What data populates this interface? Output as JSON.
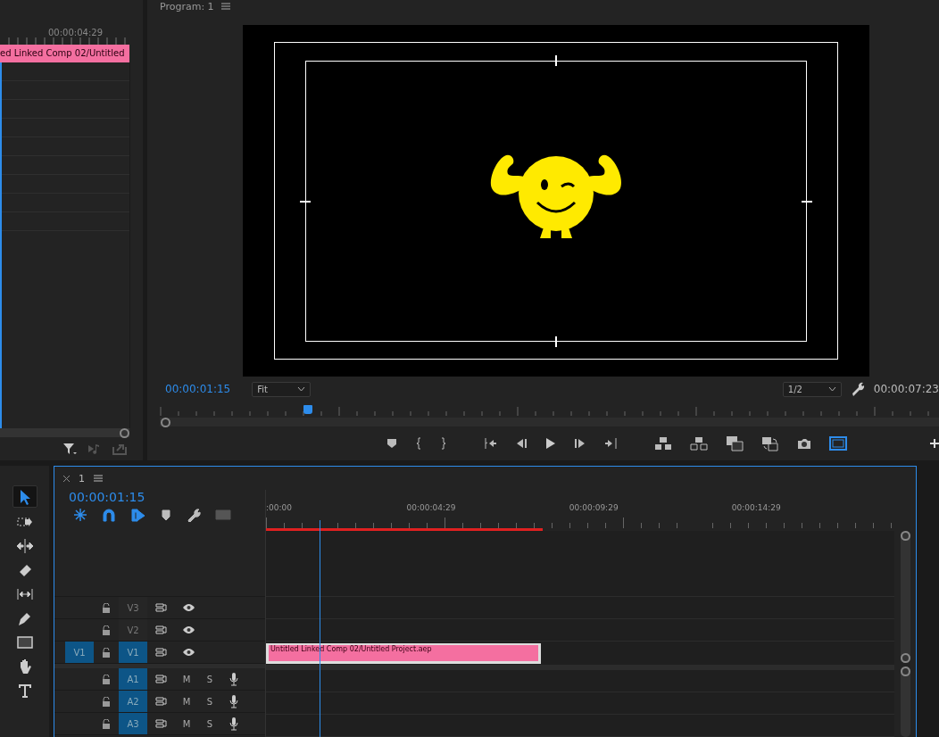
{
  "source_panel": {
    "ruler_label": "00:00:04:29",
    "clip_label": "ed Linked Comp 02/Untitled"
  },
  "program_monitor": {
    "title": "Program: 1",
    "timecode": "00:00:01:15",
    "zoom": "Fit",
    "resolution": "1/2",
    "duration": "00:00:07:23",
    "safe_margins": true,
    "playhead": {
      "level": 0.19
    }
  },
  "tools": [
    {
      "kind": "selection",
      "selected": true
    },
    {
      "kind": "track-select",
      "selected": false
    },
    {
      "kind": "ripple",
      "selected": false
    },
    {
      "kind": "razor",
      "selected": false
    },
    {
      "kind": "slip",
      "selected": false
    },
    {
      "kind": "pen",
      "selected": false
    },
    {
      "kind": "rectangle",
      "selected": false
    },
    {
      "kind": "hand",
      "selected": false
    },
    {
      "kind": "type",
      "selected": false
    }
  ],
  "timeline": {
    "tab": "1",
    "timecode": "00:00:01:15",
    "toggles": [
      {
        "kind": "nest",
        "on": true
      },
      {
        "kind": "snap",
        "on": true
      },
      {
        "kind": "linked",
        "on": true
      },
      {
        "kind": "marker",
        "on": false
      },
      {
        "kind": "settings",
        "on": false
      },
      {
        "kind": "captions",
        "on": false
      }
    ],
    "ruler_labels": [
      ":00:00",
      "00:00:04:29",
      "00:00:09:29",
      "00:00:14:29"
    ],
    "playhead": {
      "level": 0.085
    },
    "video_tracks": [
      {
        "name": "V3",
        "targeted": false
      },
      {
        "name": "V2",
        "targeted": false
      },
      {
        "name": "V1",
        "targeted": true,
        "source_patch": "V1",
        "clip": "Untitled Linked Comp 02/Untitled Project.aep"
      }
    ],
    "audio_tracks": [
      {
        "name": "A1",
        "targeted": true,
        "mute": "M",
        "solo": "S"
      },
      {
        "name": "A2",
        "targeted": true,
        "mute": "M",
        "solo": "S"
      },
      {
        "name": "A3",
        "targeted": true,
        "mute": "M",
        "solo": "S"
      }
    ]
  }
}
